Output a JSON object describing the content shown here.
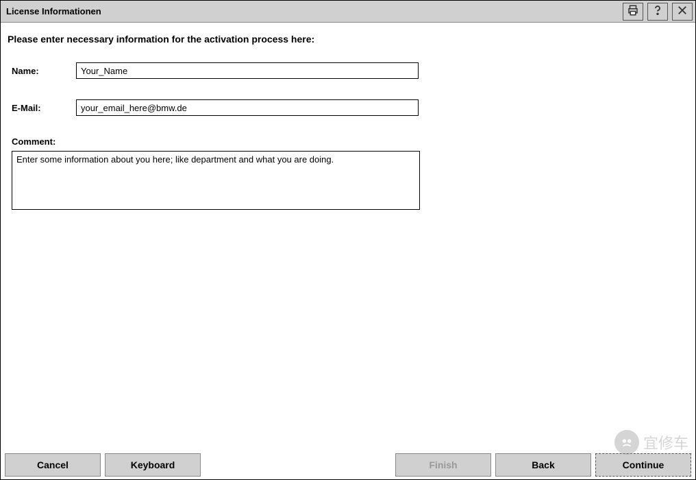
{
  "window": {
    "title": "License Informationen"
  },
  "heading": "Please enter necessary information for the activation process here:",
  "form": {
    "name": {
      "label": "Name:",
      "value": "Your_Name"
    },
    "email": {
      "label": "E-Mail:",
      "value": "your_email_here@bmw.de"
    },
    "comment": {
      "label": "Comment:",
      "value": "Enter some information about you here; like department and what you are doing."
    }
  },
  "footer": {
    "cancel": "Cancel",
    "keyboard": "Keyboard",
    "finish": "Finish",
    "back": "Back",
    "continue": "Continue"
  },
  "watermark": "宜修车"
}
